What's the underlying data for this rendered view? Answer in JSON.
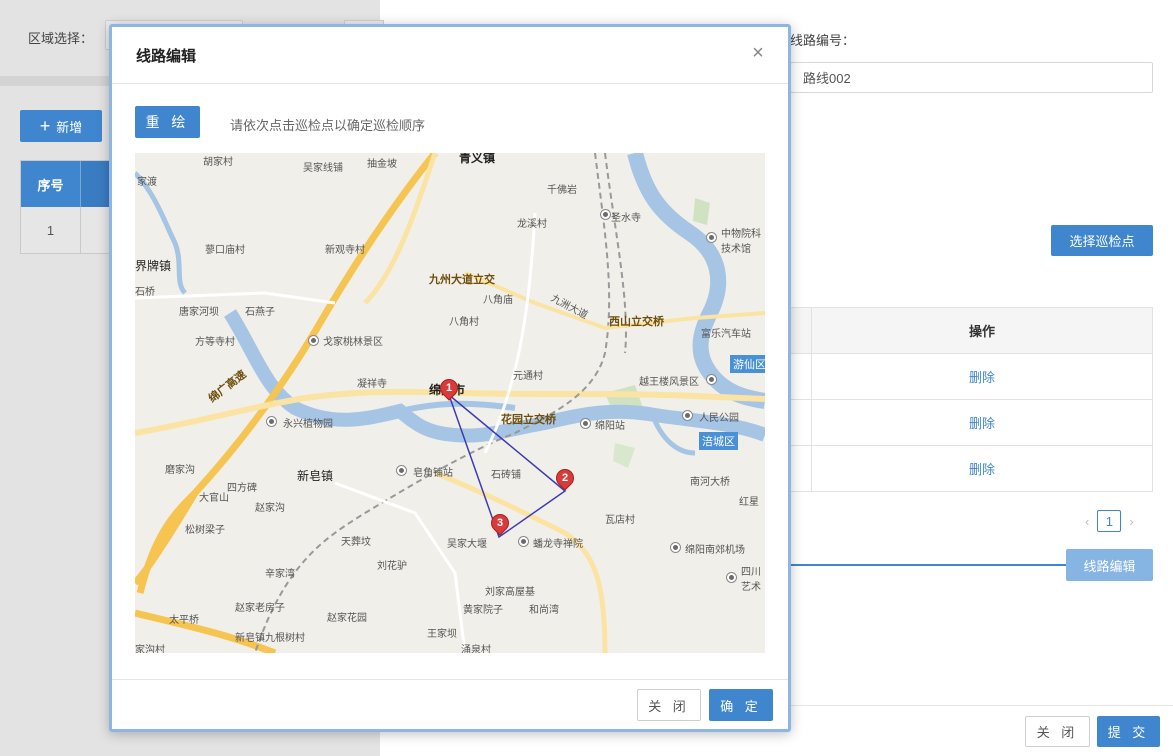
{
  "background": {
    "filter_label": "区域选择：",
    "add_button": "新增",
    "table": {
      "col_index": "序号",
      "rows": [
        {
          "index": "1"
        }
      ]
    }
  },
  "right_panel": {
    "route_no_label": "线路编号：",
    "route_no_value": "路线002",
    "select_points_button": "选择巡检点",
    "table_header_op": "操作",
    "rows": [
      {
        "op": "删除"
      },
      {
        "op": "删除"
      },
      {
        "op": "删除"
      }
    ],
    "page_current": "1",
    "route_edit_button": "线路编辑",
    "close_button": "关 闭",
    "submit_button": "提 交"
  },
  "modal": {
    "title": "线路编辑",
    "close_symbol": "×",
    "redraw_button": "重 绘",
    "hint": "请依次点击巡检点以确定巡检顺序",
    "close_button": "关 闭",
    "ok_button": "确 定"
  },
  "map": {
    "labels": [
      "胡家村",
      "吴家线铺",
      "抽金坡",
      "青义镇",
      "家渡",
      "千佛岩",
      "圣水寺",
      "龙溪村",
      "中物院科技术馆",
      "蓼口庙村",
      "新观寺村",
      "界牌镇",
      "九州大道立交",
      "八角庙",
      "九洲大道",
      "石桥",
      "石燕子",
      "唐家河坝",
      "八角村",
      "西山立交桥",
      "富乐汽车站",
      "方等寺村",
      "戈家桃林景区",
      "游仙区",
      "绵广高速",
      "凝祥寺",
      "元通村",
      "越王楼风景区",
      "绵阳市",
      "永兴植物园",
      "花园立交桥",
      "绵阳站",
      "人民公园",
      "涪城区",
      "磨家沟",
      "新皂镇",
      "皂角铺站",
      "石砖铺",
      "南河大桥",
      "四方碑",
      "大官山",
      "赵家沟",
      "红星",
      "松树梁子",
      "瓦店村",
      "天葬坟",
      "吴家大堰",
      "蟠龙寺禅院",
      "绵阳南郊机场",
      "辛家湾",
      "刘花驴",
      "四川艺术",
      "赵家老房子",
      "赵家花园",
      "刘家高屋基",
      "黄家院子",
      "和尚湾",
      "太平桥",
      "新皂镇九根树村",
      "王家坝",
      "家沟村",
      "涌泉村"
    ],
    "waypoints": [
      {
        "number": "1"
      },
      {
        "number": "2"
      },
      {
        "number": "3"
      }
    ],
    "road_shields": [
      "G5",
      "G5",
      "G5"
    ]
  }
}
